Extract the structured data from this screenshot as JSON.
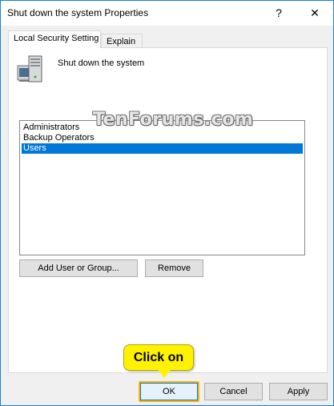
{
  "window": {
    "title": "Shut down the system Properties",
    "help_glyph": "?",
    "close_glyph": "✕"
  },
  "tabs": [
    {
      "label": "Local Security Setting",
      "selected": true
    },
    {
      "label": "Explain",
      "selected": false
    }
  ],
  "policy": {
    "name": "Shut down the system",
    "icon": "server-computer-icon"
  },
  "members": [
    {
      "label": "Administrators",
      "selected": false
    },
    {
      "label": "Backup Operators",
      "selected": false
    },
    {
      "label": "Users",
      "selected": true
    }
  ],
  "actions": {
    "add_label": "Add User or Group...",
    "remove_label": "Remove"
  },
  "footer": {
    "ok_label": "OK",
    "cancel_label": "Cancel",
    "apply_label": "Apply"
  },
  "callout": {
    "text": "Click on"
  },
  "watermark": {
    "text": "TenForums.com"
  },
  "colors": {
    "selection": "#0078d7",
    "callout": "#fff200",
    "border_accent": "#1883d7"
  }
}
